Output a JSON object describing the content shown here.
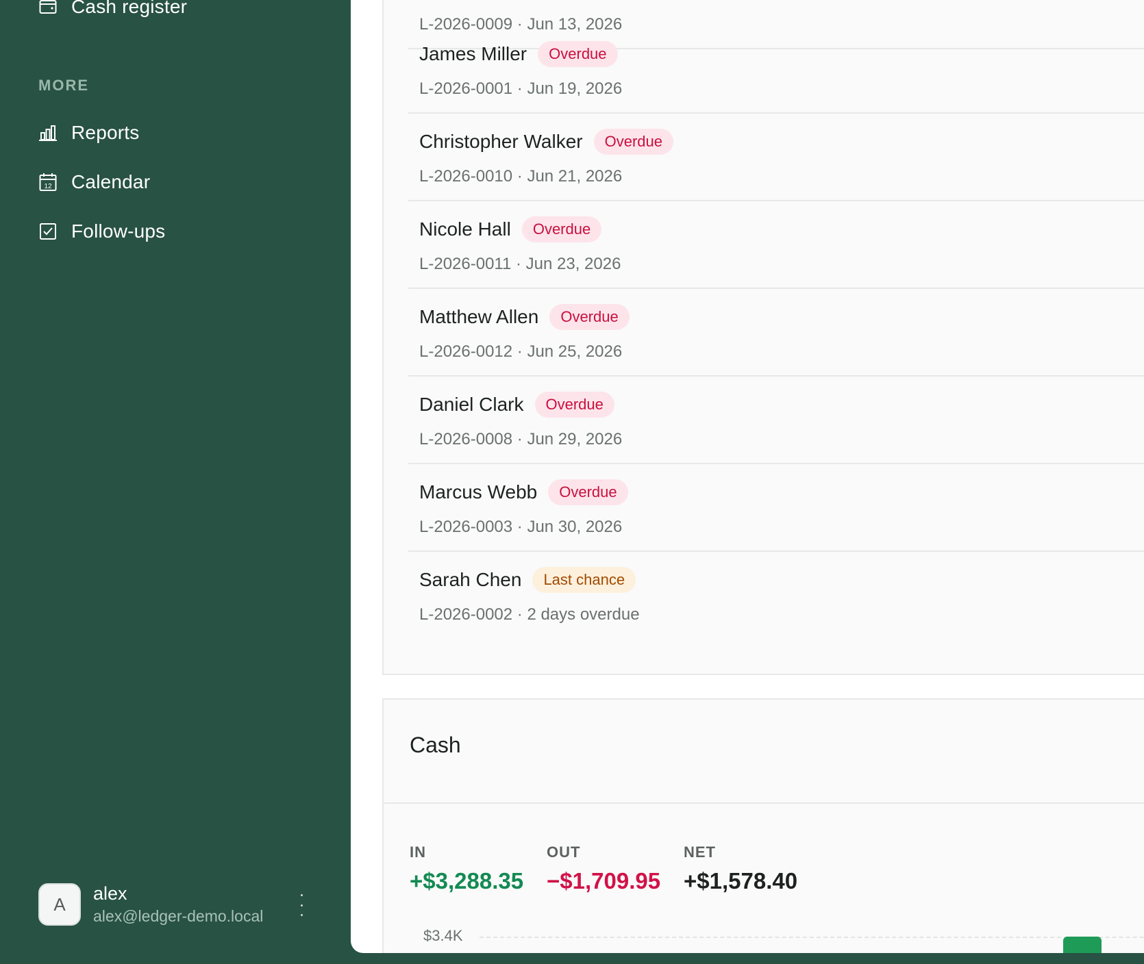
{
  "sidebar": {
    "top_item": {
      "label": "Cash register",
      "icon": "wallet-icon"
    },
    "section_label": "MORE",
    "items": [
      {
        "label": "Reports",
        "icon": "bar-chart-icon"
      },
      {
        "label": "Calendar",
        "icon": "calendar-icon",
        "icon_text": "12"
      },
      {
        "label": "Follow-ups",
        "icon": "checkbox-icon"
      }
    ],
    "user": {
      "initial": "A",
      "name": "alex",
      "email": "alex@ledger-demo.local"
    }
  },
  "loans": {
    "partial_row_sub": "L-2026-0009 · Jun 13, 2026",
    "rows": [
      {
        "name": "James Miller",
        "status": "Overdue",
        "sub": "L-2026-0001 · Jun 19, 2026"
      },
      {
        "name": "Christopher Walker",
        "status": "Overdue",
        "sub": "L-2026-0010 · Jun 21, 2026"
      },
      {
        "name": "Nicole Hall",
        "status": "Overdue",
        "sub": "L-2026-0011 · Jun 23, 2026"
      },
      {
        "name": "Matthew Allen",
        "status": "Overdue",
        "sub": "L-2026-0012 · Jun 25, 2026"
      },
      {
        "name": "Daniel Clark",
        "status": "Overdue",
        "sub": "L-2026-0008 · Jun 29, 2026"
      },
      {
        "name": "Marcus Webb",
        "status": "Overdue",
        "sub": "L-2026-0003 · Jun 30, 2026"
      },
      {
        "name": "Sarah Chen",
        "status": "Last chance",
        "sub": "L-2026-0002 · 2 days overdue"
      }
    ]
  },
  "cash": {
    "title": "Cash",
    "in_label": "IN",
    "in_value": "+$3,288.35",
    "out_label": "OUT",
    "out_value": "−$1,709.95",
    "net_label": "NET",
    "net_value": "+$1,578.40",
    "axis_top_tick": "$3.4K"
  },
  "colors": {
    "sidebar_bg": "#285243",
    "overdue_badge": "#c8103f",
    "last_chance_badge": "#a14a00",
    "in_color": "#138a53",
    "out_color": "#d11248"
  }
}
